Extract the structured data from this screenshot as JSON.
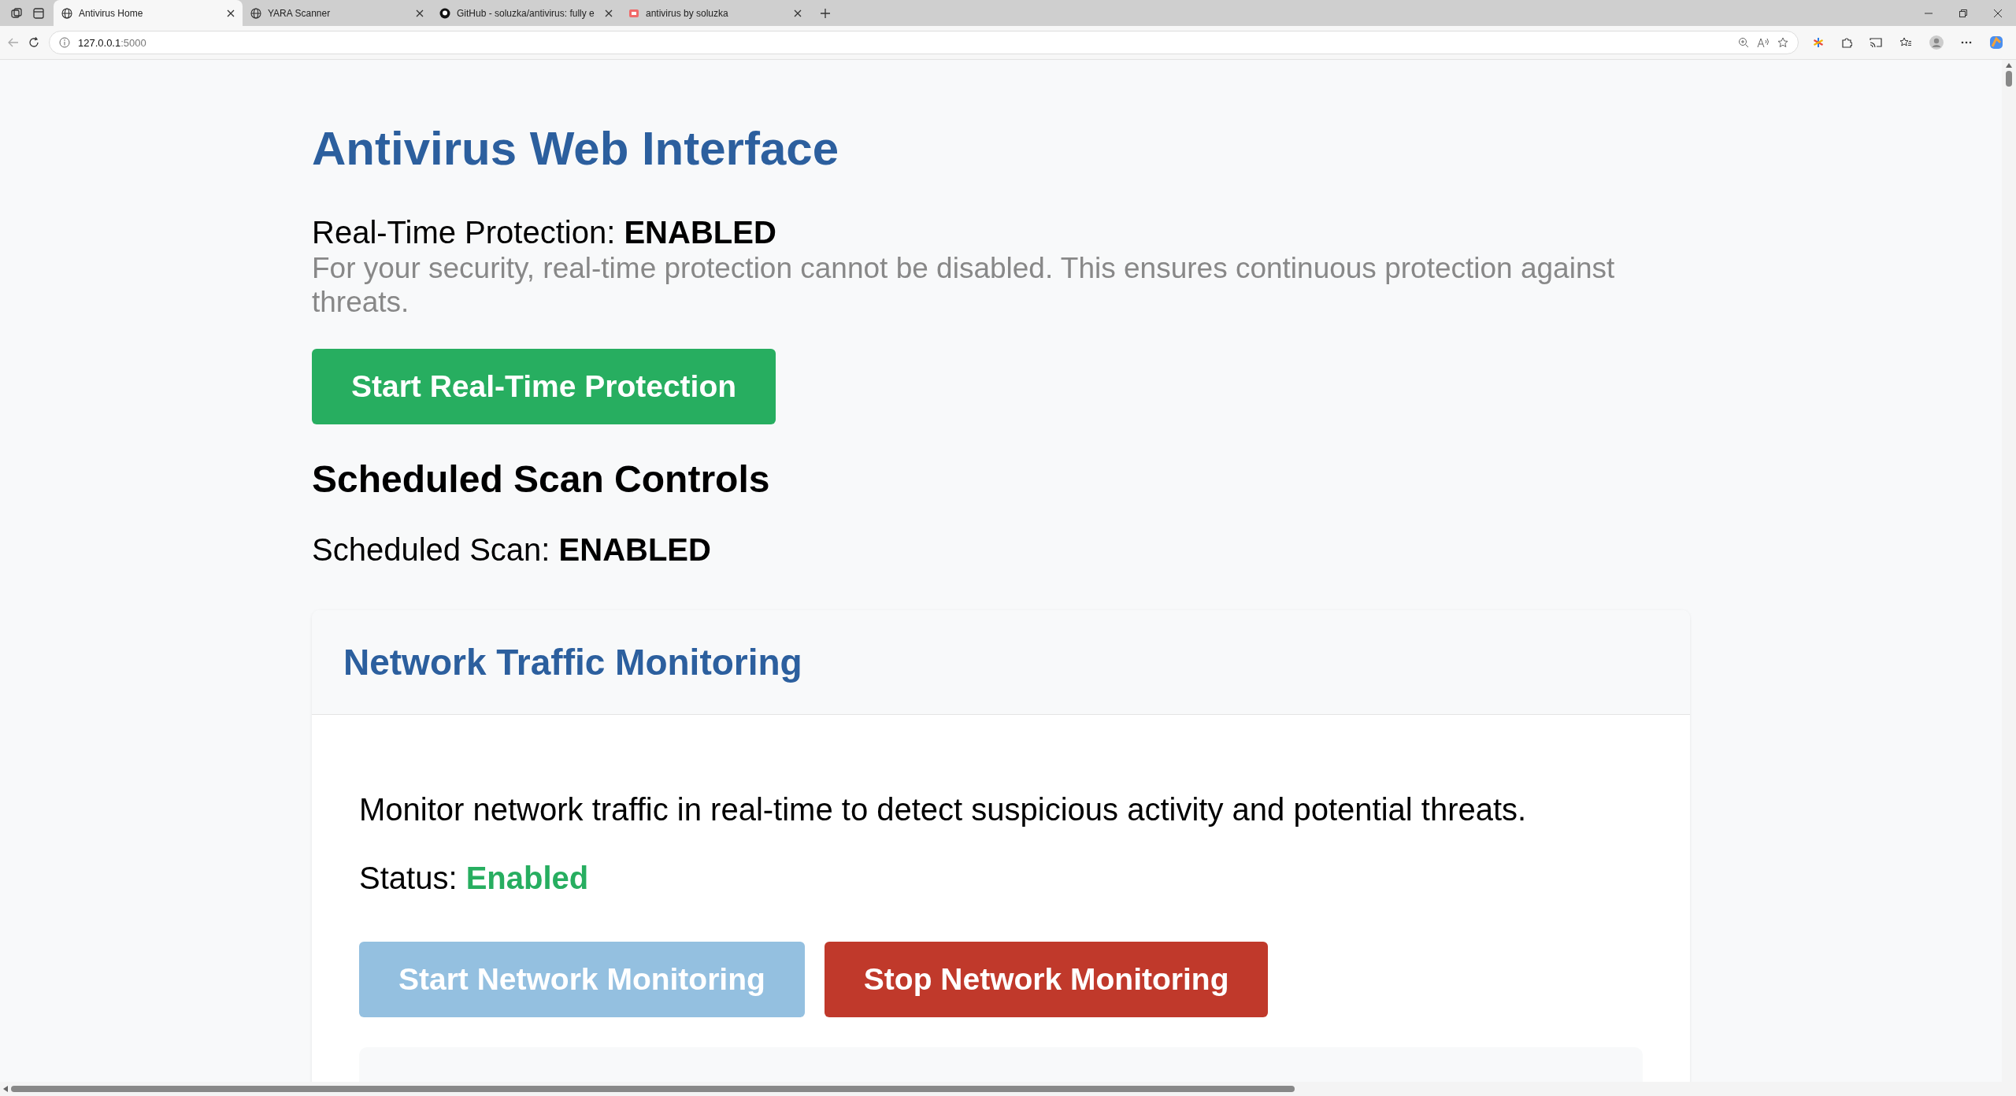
{
  "browser": {
    "tabs": [
      {
        "title": "Antivirus Home",
        "kind": "globe",
        "selected": true
      },
      {
        "title": "YARA Scanner",
        "kind": "globe",
        "selected": false
      },
      {
        "title": "GitHub - soluzka/antivirus: fully e",
        "kind": "github",
        "selected": false
      },
      {
        "title": "antivirus by soluzka",
        "kind": "site",
        "selected": false
      }
    ],
    "address": {
      "host": "127.0.0.1",
      "port": ":5000"
    }
  },
  "page": {
    "title": "Antivirus Web Interface",
    "realtime": {
      "label": "Real-Time Protection: ",
      "value": "ENABLED",
      "note": "For your security, real-time protection cannot be disabled. This ensures continuous protection against threats."
    },
    "realtime_button": {
      "label": "Start Real-Time Protection",
      "disabled": false
    },
    "scheduled_heading": "Scheduled Scan Controls",
    "scheduled": {
      "label": "Scheduled Scan: ",
      "value": "ENABLED"
    },
    "card": {
      "title": "Network Traffic Monitoring",
      "description": "Monitor network traffic in real-time to detect suspicious activity and potential threats.",
      "status_label": "Status: ",
      "status_value": "Enabled",
      "status_on": true,
      "buttons": [
        {
          "label": "Start Network Monitoring",
          "kind": "start",
          "disabled": true
        },
        {
          "label": "Stop Network Monitoring",
          "kind": "stop",
          "disabled": false
        }
      ]
    }
  }
}
